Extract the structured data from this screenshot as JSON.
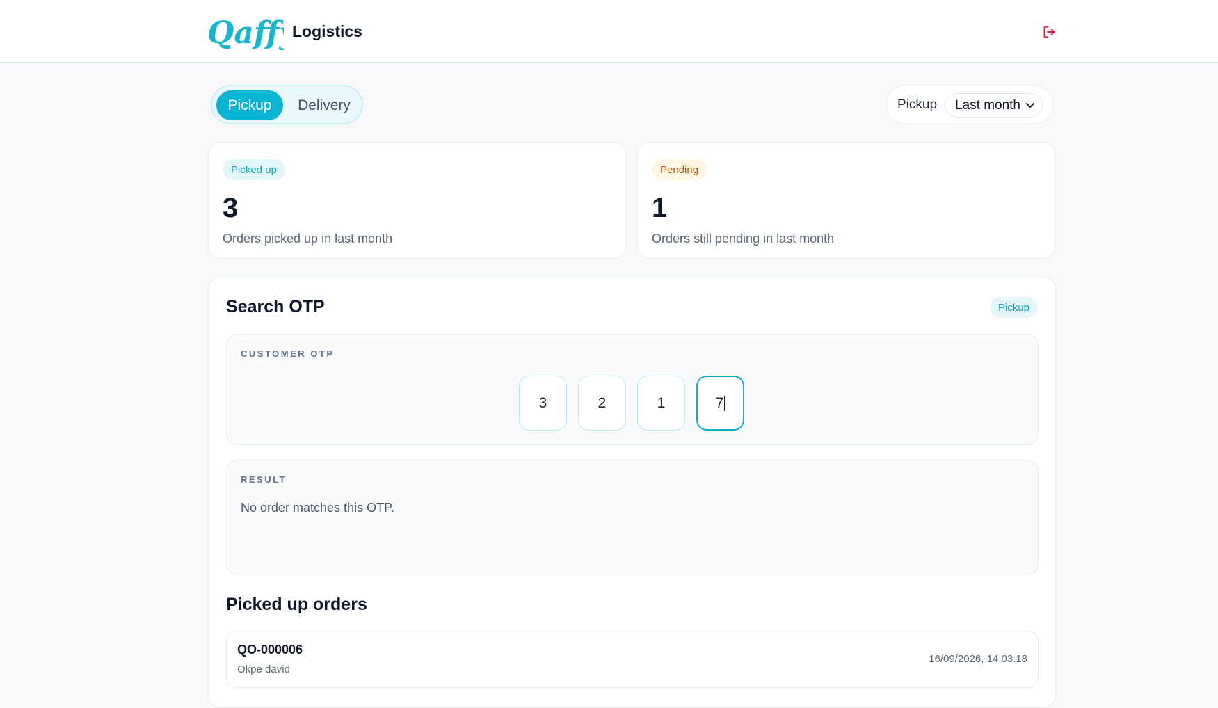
{
  "header": {
    "logo_text": "Qaffy",
    "title": "Logistics",
    "logout_icon": "logout-icon",
    "accent_color": "#07b5d3",
    "logout_color": "#e11d48"
  },
  "mode_toggle": {
    "options": [
      "Pickup",
      "Delivery"
    ],
    "selected": "Pickup"
  },
  "filter": {
    "label": "Pickup",
    "period": "Last month"
  },
  "stats": [
    {
      "badge": "Picked up",
      "value": "3",
      "description": "Orders picked up in last month"
    },
    {
      "badge": "Pending",
      "value": "1",
      "description": "Orders still pending in last month"
    }
  ],
  "search": {
    "title": "Search OTP",
    "badge": "Pickup",
    "otp_label": "CUSTOMER OTP",
    "otp_digits": [
      "3",
      "2",
      "1",
      "7"
    ],
    "result_label": "RESULT",
    "result_text": "No order matches this OTP."
  },
  "orders": {
    "title": "Picked up orders",
    "items": [
      {
        "id": "QO-000006",
        "customer": "Okpe david",
        "timestamp": "16/09/2026, 14:03:18"
      }
    ]
  }
}
